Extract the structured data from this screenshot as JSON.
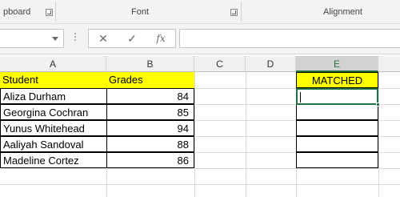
{
  "ribbon": {
    "groups": [
      {
        "label": "pboard"
      },
      {
        "label": "Font"
      },
      {
        "label": "Alignment"
      }
    ]
  },
  "formula_bar": {
    "name_box_value": "",
    "cancel_icon": "close-icon",
    "enter_icon": "checkmark-icon",
    "function_label": "fx",
    "formula_value": ""
  },
  "sheet": {
    "columns": [
      "A",
      "B",
      "C",
      "D",
      "E"
    ],
    "selected_column": "E",
    "headers": {
      "student": "Student",
      "grades": "Grades",
      "matched": "MATCHED"
    },
    "rows": [
      {
        "student": "Aliza Durham",
        "grade": "84"
      },
      {
        "student": "Georgina Cochran",
        "grade": "85"
      },
      {
        "student": "Yunus Whitehead",
        "grade": "94"
      },
      {
        "student": "Aaliyah Sandoval",
        "grade": "88"
      },
      {
        "student": "Madeline Cortez",
        "grade": "86"
      }
    ],
    "colors": {
      "header_fill": "#ffff00",
      "selection": "#217346"
    }
  }
}
